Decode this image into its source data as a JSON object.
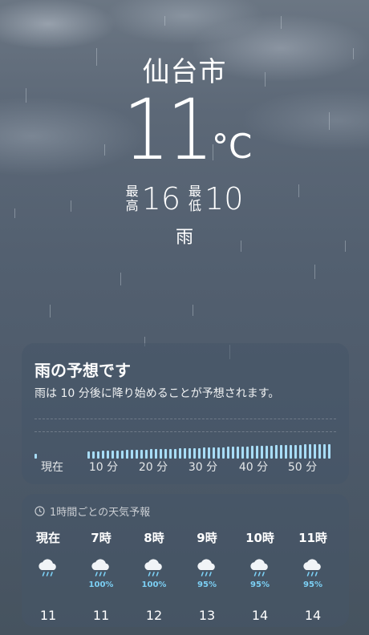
{
  "header": {
    "city": "仙台市",
    "temperature": "11",
    "unit": "°C",
    "high_label": [
      "最",
      "高"
    ],
    "high": "16",
    "low_label": [
      "最",
      "低"
    ],
    "low": "10",
    "condition": "雨"
  },
  "rain_card": {
    "title": "雨の予想です",
    "subtitle": "雨は 10 分後に降り始めることが予想されます。",
    "ticks": [
      "現在",
      "10 分",
      "20 分",
      "30 分",
      "40 分",
      "50 分"
    ],
    "intensity_start_fraction": 0.27,
    "bar_color": "#a8ddf7"
  },
  "hourly_card": {
    "heading": "1時間ごとの天気予報",
    "hours": [
      {
        "time": "現在",
        "icon": "cloud-rain-icon",
        "pct": "",
        "temp": "11"
      },
      {
        "time": "7時",
        "icon": "cloud-rain-icon",
        "pct": "100%",
        "temp": "11"
      },
      {
        "time": "8時",
        "icon": "cloud-rain-icon",
        "pct": "100%",
        "temp": "12"
      },
      {
        "time": "9時",
        "icon": "cloud-rain-icon",
        "pct": "95%",
        "temp": "13"
      },
      {
        "time": "10時",
        "icon": "cloud-rain-icon",
        "pct": "95%",
        "temp": "14"
      },
      {
        "time": "11時",
        "icon": "cloud-rain-icon",
        "pct": "95%",
        "temp": "14"
      }
    ],
    "pct_color": "#7cd0f5"
  }
}
